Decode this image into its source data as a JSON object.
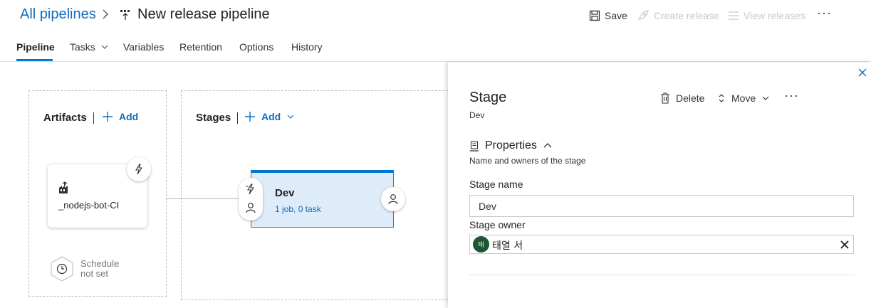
{
  "header": {
    "breadcrumb_root": "All pipelines",
    "title": "New release pipeline",
    "commands": {
      "save": "Save",
      "create_release": "Create release",
      "view_releases": "View releases",
      "more": "···"
    }
  },
  "tabs": [
    {
      "label": "Pipeline",
      "active": true
    },
    {
      "label": "Tasks"
    },
    {
      "label": "Variables"
    },
    {
      "label": "Retention"
    },
    {
      "label": "Options"
    },
    {
      "label": "History"
    }
  ],
  "artifacts": {
    "title": "Artifacts",
    "add_label": "Add",
    "items": [
      {
        "name": "_nodejs-bot-CI"
      }
    ],
    "schedule_line1": "Schedule",
    "schedule_line2": "not set"
  },
  "stages": {
    "title": "Stages",
    "add_label": "Add",
    "items": [
      {
        "name": "Dev",
        "summary": "1 job, 0 task"
      }
    ]
  },
  "panel": {
    "title": "Stage",
    "subtitle": "Dev",
    "delete_label": "Delete",
    "move_label": "Move",
    "more": "···",
    "section_title": "Properties",
    "section_desc": "Name and owners of the stage",
    "stage_name_label": "Stage name",
    "stage_name_value": "Dev",
    "stage_owner_label": "Stage owner",
    "owner": {
      "initials": "태",
      "name": "태열 서"
    }
  },
  "colors": {
    "accent": "#0078d4",
    "link": "#106ebe",
    "stage_fill": "#deecf9",
    "owner_avatar": "#1e5631"
  }
}
